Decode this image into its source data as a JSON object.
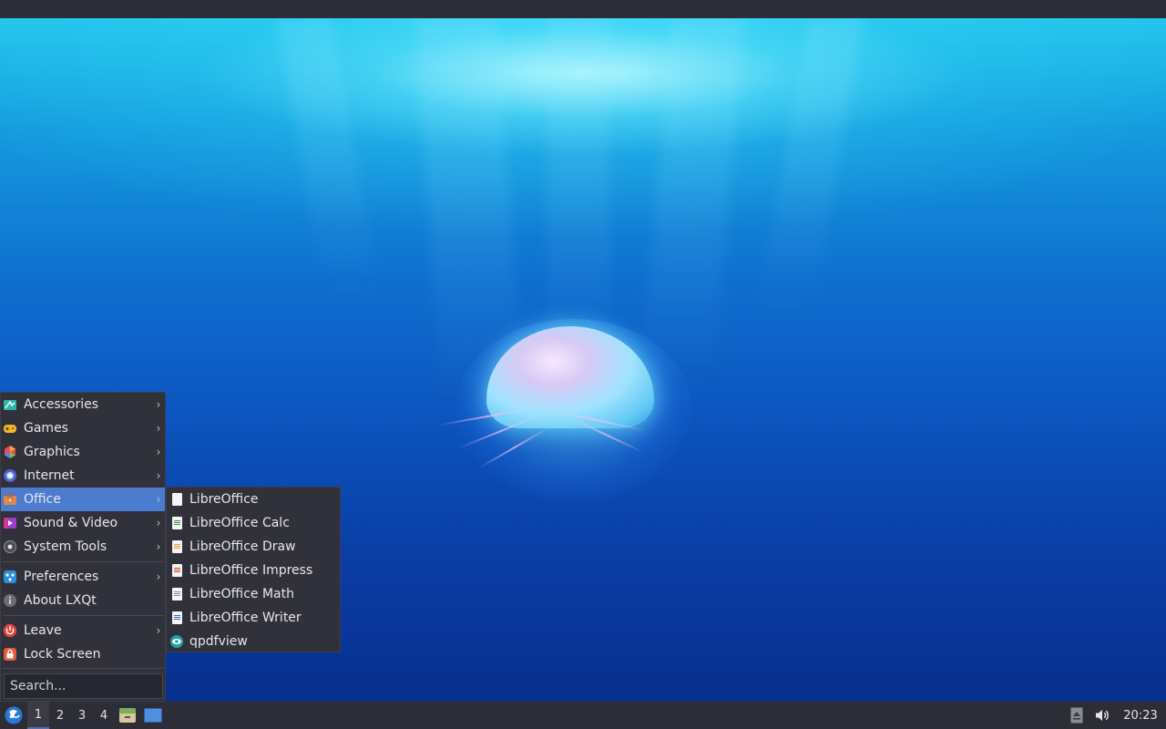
{
  "menu": {
    "items": [
      {
        "label": "Accessories",
        "icon": "accessories-icon",
        "submenu": true
      },
      {
        "label": "Games",
        "icon": "games-icon",
        "submenu": true
      },
      {
        "label": "Graphics",
        "icon": "graphics-icon",
        "submenu": true
      },
      {
        "label": "Internet",
        "icon": "internet-icon",
        "submenu": true
      },
      {
        "label": "Office",
        "icon": "office-icon",
        "submenu": true,
        "highlighted": true
      },
      {
        "label": "Sound & Video",
        "icon": "sound-video-icon",
        "submenu": true
      },
      {
        "label": "System Tools",
        "icon": "system-tools-icon",
        "submenu": true
      },
      {
        "label": "Preferences",
        "icon": "preferences-icon",
        "submenu": true
      },
      {
        "label": "About LXQt",
        "icon": "about-icon",
        "submenu": false
      },
      {
        "label": "Leave",
        "icon": "power-icon",
        "submenu": true
      },
      {
        "label": "Lock Screen",
        "icon": "lock-icon",
        "submenu": false
      }
    ],
    "search_placeholder": "Search..."
  },
  "office_submenu": {
    "items": [
      {
        "label": "LibreOffice",
        "icon": "libreoffice-icon"
      },
      {
        "label": "LibreOffice Calc",
        "icon": "libreoffice-calc-icon"
      },
      {
        "label": "LibreOffice Draw",
        "icon": "libreoffice-draw-icon"
      },
      {
        "label": "LibreOffice Impress",
        "icon": "libreoffice-impress-icon"
      },
      {
        "label": "LibreOffice Math",
        "icon": "libreoffice-math-icon"
      },
      {
        "label": "LibreOffice Writer",
        "icon": "libreoffice-writer-icon"
      },
      {
        "label": "qpdfview",
        "icon": "qpdfview-icon"
      }
    ]
  },
  "taskbar": {
    "desktops": [
      "1",
      "2",
      "3",
      "4"
    ],
    "active_desktop": "1",
    "clock": "20:23"
  },
  "colors": {
    "panel": "#2c2d36",
    "menu_bg": "#30313b",
    "highlight": "#4c7cd0"
  }
}
